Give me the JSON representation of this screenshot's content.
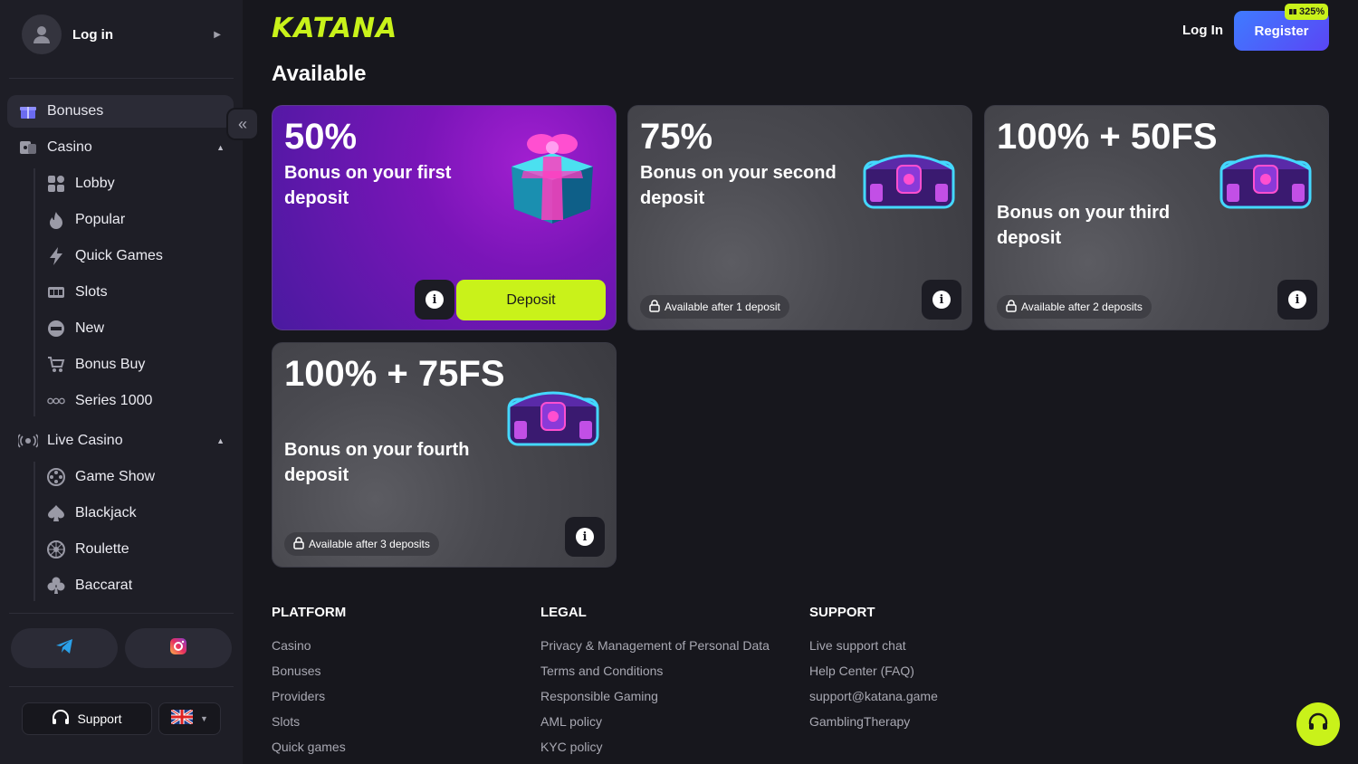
{
  "sidebar": {
    "login_label": "Log in",
    "items": [
      {
        "label": "Bonuses",
        "icon": "gift-icon",
        "active": true
      },
      {
        "label": "Casino",
        "icon": "casino-icon"
      },
      {
        "label": "Live Casino",
        "icon": "broadcast-icon"
      }
    ],
    "casino_sub": [
      {
        "label": "Lobby",
        "icon": "grid-icon"
      },
      {
        "label": "Popular",
        "icon": "flame-icon"
      },
      {
        "label": "Quick Games",
        "icon": "lightning-icon"
      },
      {
        "label": "Slots",
        "icon": "slot-machine-icon"
      },
      {
        "label": "New",
        "icon": "new-badge-icon"
      },
      {
        "label": "Bonus Buy",
        "icon": "cart-icon"
      },
      {
        "label": "Series 1000",
        "icon": "series-1000-icon"
      }
    ],
    "live_sub": [
      {
        "label": "Game Show",
        "icon": "film-reel-icon"
      },
      {
        "label": "Blackjack",
        "icon": "spade-icon"
      },
      {
        "label": "Roulette",
        "icon": "roulette-icon"
      },
      {
        "label": "Baccarat",
        "icon": "club-icon"
      }
    ],
    "support_label": "Support",
    "language": "EN"
  },
  "header": {
    "logo": "KATANA",
    "login_label": "Log In",
    "register_label": "Register",
    "register_badge": "325%"
  },
  "main": {
    "section_title": "Available",
    "cards": [
      {
        "percent": "50%",
        "desc": "Bonus on your first deposit",
        "action": "Deposit"
      },
      {
        "percent": "75%",
        "desc": "Bonus on your second deposit",
        "lock_text": "Available after 1 deposit"
      },
      {
        "percent": "100% + 50FS",
        "desc": "Bonus on your third deposit",
        "lock_text": "Available after 2 deposits"
      },
      {
        "percent": "100% + 75FS",
        "desc": "Bonus on your fourth deposit",
        "lock_text": "Available after 3 deposits"
      }
    ]
  },
  "footer": {
    "platform": {
      "title": "PLATFORM",
      "links": [
        "Casino",
        "Bonuses",
        "Providers",
        "Slots",
        "Quick games"
      ]
    },
    "legal": {
      "title": "LEGAL",
      "links": [
        "Privacy & Management of Personal Data",
        "Terms and Conditions",
        "Responsible Gaming",
        "AML policy",
        "KYC policy"
      ]
    },
    "support": {
      "title": "SUPPORT",
      "links": [
        "Live support chat",
        "Help Center (FAQ)",
        "support@katana.game",
        "GamblingTherapy"
      ]
    }
  },
  "colors": {
    "accent": "#c9f21a",
    "register": "#4a5cf8",
    "bg": "#17171d",
    "sidebar": "#1e1e26"
  }
}
